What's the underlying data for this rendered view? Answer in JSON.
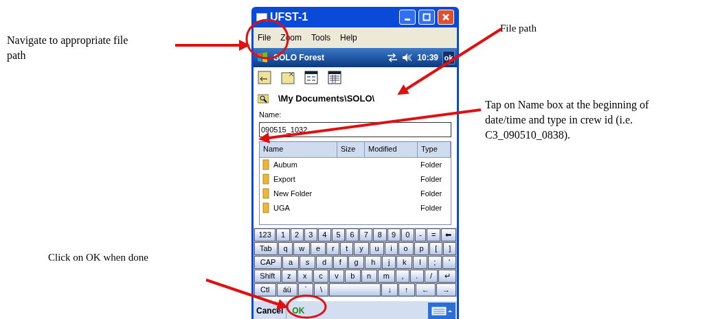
{
  "annotations": [
    {
      "text": "Navigate to appropriate file path"
    },
    {
      "text": "File path"
    },
    {
      "text": "Tap on Name box at the beginning of date/time and type in crew id (i.e. C3_090510_0838)."
    },
    {
      "text": "Click on OK when done"
    }
  ],
  "window": {
    "title": "UFST-1"
  },
  "menu": [
    "File",
    "Zoom",
    "Tools",
    "Help"
  ],
  "status_bar": {
    "app": "SOLO Forest",
    "time": "10:39",
    "button": "ok"
  },
  "path": "\\My Documents\\SOLO\\",
  "name_field": {
    "label": "Name:",
    "value": "090515_1032"
  },
  "table": {
    "columns": [
      "Name",
      "Size",
      "Modified",
      "Type"
    ],
    "rows": [
      {
        "name": "Aubum",
        "type": "Folder"
      },
      {
        "name": "Export",
        "type": "Folder"
      },
      {
        "name": "New Folder",
        "type": "Folder"
      },
      {
        "name": "UGA",
        "type": "Folder"
      }
    ]
  },
  "keyboard": [
    [
      {
        "label": "123"
      },
      {
        "label": "1"
      },
      {
        "label": "2"
      },
      {
        "label": "3"
      },
      {
        "label": "4"
      },
      {
        "label": "5"
      },
      {
        "label": "6"
      },
      {
        "label": "7"
      },
      {
        "label": "8"
      },
      {
        "label": "9"
      },
      {
        "label": "0"
      },
      {
        "label": "-"
      },
      {
        "label": "="
      },
      {
        "label": "⬅"
      }
    ],
    [
      {
        "label": "Tab"
      },
      {
        "label": "q"
      },
      {
        "label": "w"
      },
      {
        "label": "e"
      },
      {
        "label": "r"
      },
      {
        "label": "t"
      },
      {
        "label": "y"
      },
      {
        "label": "u"
      },
      {
        "label": "i"
      },
      {
        "label": "o"
      },
      {
        "label": "p"
      },
      {
        "label": "["
      },
      {
        "label": "]"
      }
    ],
    [
      {
        "label": "CAP"
      },
      {
        "label": "a"
      },
      {
        "label": "s"
      },
      {
        "label": "d"
      },
      {
        "label": "f"
      },
      {
        "label": "g"
      },
      {
        "label": "h"
      },
      {
        "label": "j"
      },
      {
        "label": "k"
      },
      {
        "label": "l"
      },
      {
        "label": ";"
      },
      {
        "label": "'"
      }
    ],
    [
      {
        "label": "Shift"
      },
      {
        "label": "z"
      },
      {
        "label": "x"
      },
      {
        "label": "c"
      },
      {
        "label": "v"
      },
      {
        "label": "b"
      },
      {
        "label": "n"
      },
      {
        "label": "m"
      },
      {
        "label": ","
      },
      {
        "label": "."
      },
      {
        "label": "/"
      },
      {
        "label": "↵"
      }
    ],
    [
      {
        "label": "Ctl"
      },
      {
        "label": "áü"
      },
      {
        "label": "`"
      },
      {
        "label": "\\"
      },
      {
        "kind": "space"
      },
      {
        "label": "↓"
      },
      {
        "label": "↑"
      },
      {
        "label": "←"
      },
      {
        "label": "→"
      }
    ]
  ],
  "bottom_bar": {
    "left": "Cancel",
    "right": "OK"
  }
}
